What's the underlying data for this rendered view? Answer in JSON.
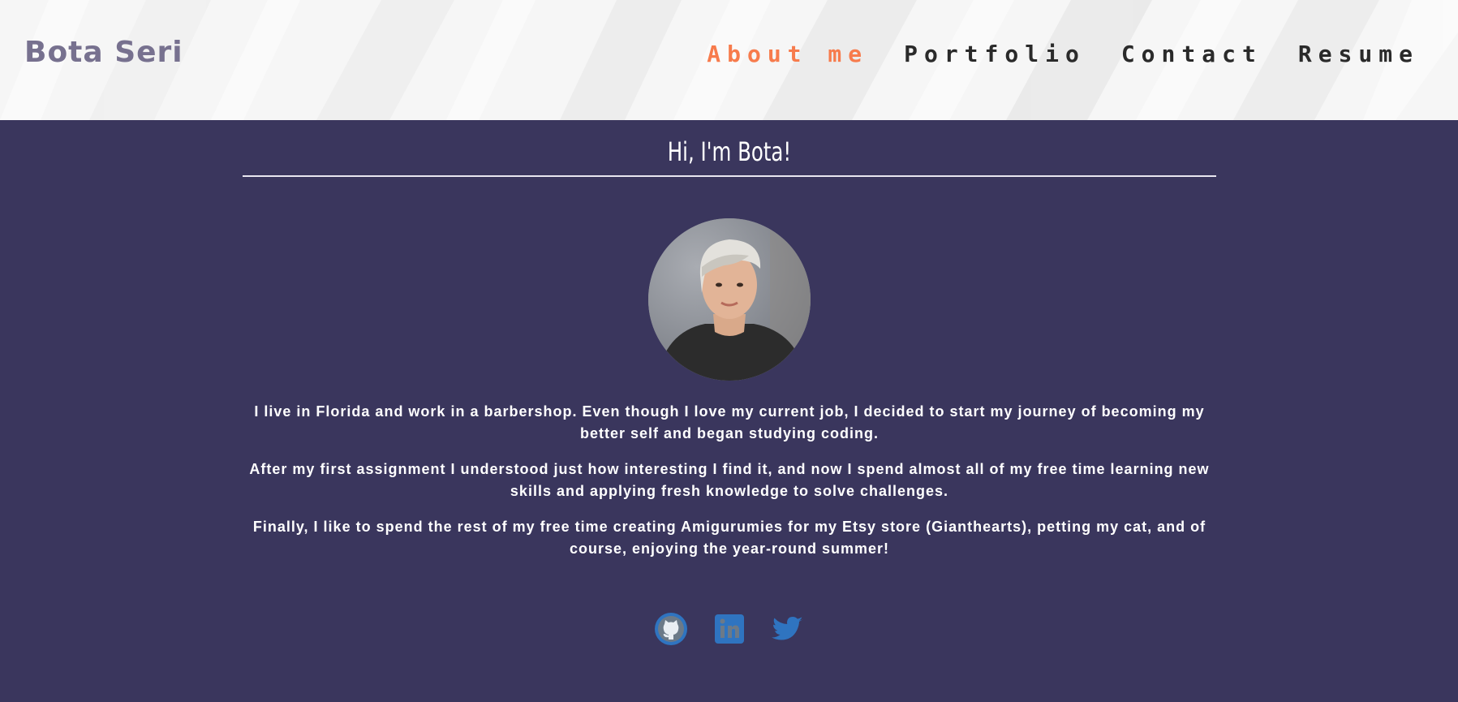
{
  "header": {
    "brand": "Bota Seri",
    "nav": [
      {
        "label": "About me",
        "active": true
      },
      {
        "label": "Portfolio",
        "active": false
      },
      {
        "label": "Contact",
        "active": false
      },
      {
        "label": "Resume",
        "active": false
      }
    ]
  },
  "main": {
    "title": "Hi, I'm Bota!",
    "paragraphs": [
      "I live in Florida and work in a barbershop. Even though I love my current job, I decided to start my journey of becoming my better self and began studying coding.",
      "After my first assignment I understood just how interesting I find it, and now I spend almost all of my free time learning new skills and applying fresh knowledge to solve challenges.",
      "Finally, I like to spend the rest of my free time creating Amigurumies for my Etsy store (Gianthearts), petting my cat, and of course, enjoying the year-round summer!"
    ]
  },
  "socials": [
    {
      "icon": "github-icon"
    },
    {
      "icon": "linkedin-icon"
    },
    {
      "icon": "twitter-icon"
    }
  ],
  "colors": {
    "background": "#3a365d",
    "accent": "#f77b4c",
    "brand": "#77718f",
    "social": "#2f74c0"
  }
}
